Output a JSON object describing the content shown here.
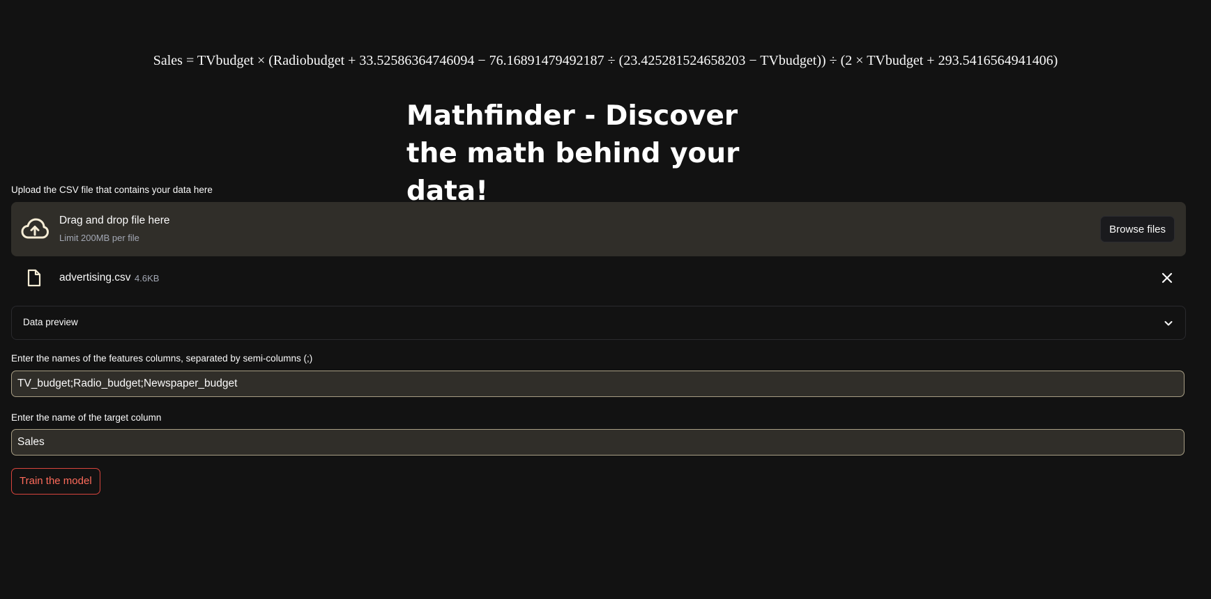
{
  "formula": {
    "text": "Sales = TVbudget × (Radiobudget + 33.52586364746094 − 76.16891479492187 ÷ (23.425281524658203 − TVbudget)) ÷ (2 × TVbudget + 293.5416564941406)"
  },
  "title": "Mathfinder - Discover the math behind your data!",
  "upload": {
    "label": "Upload the CSV file that contains your data here",
    "drop_title": "Drag and drop file here",
    "limit": "Limit 200MB per file",
    "browse_label": "Browse files",
    "icon": "cloud-upload-icon"
  },
  "uploaded_file": {
    "name": "advertising.csv",
    "size": "4.6KB",
    "icon": "file-icon",
    "close_icon": "close-icon"
  },
  "data_preview": {
    "label": "Data preview",
    "icon": "chevron-down-icon"
  },
  "features": {
    "label": "Enter the names of the features columns, separated by semi-columns (;)",
    "value": "TV_budget;Radio_budget;Newspaper_budget"
  },
  "target": {
    "label": "Enter the name of the target column",
    "value": "Sales"
  },
  "train_button": {
    "label": "Train the model"
  },
  "colors": {
    "background": "#121212",
    "panel": "#302e29",
    "input_border": "#a89e84",
    "accent": "#ff6b5b",
    "upload_icon": "#f5ecd5"
  }
}
